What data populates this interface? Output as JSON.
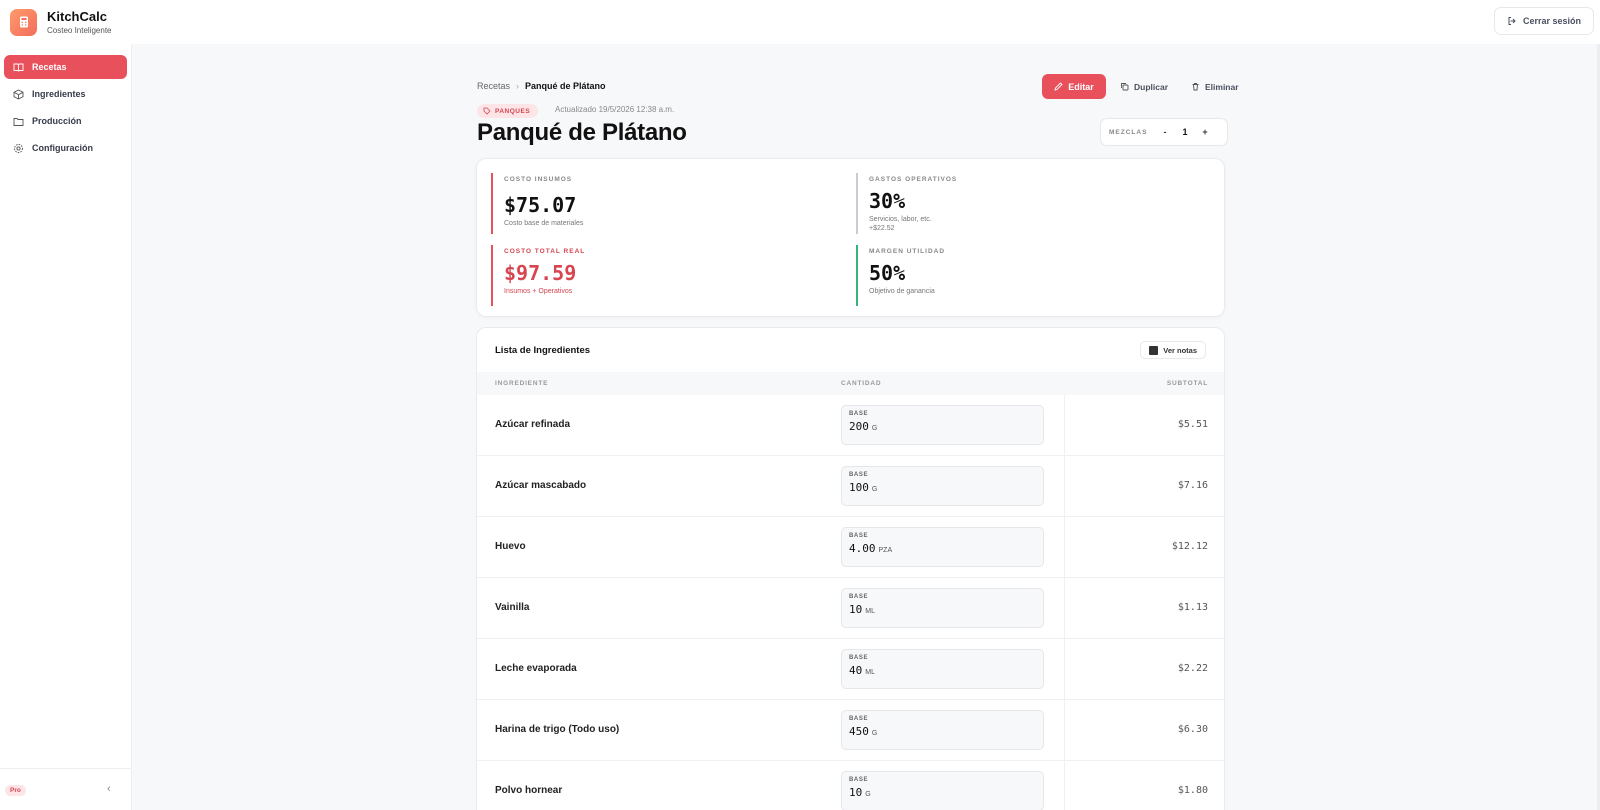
{
  "app": {
    "name": "KitchCalc",
    "tagline": "Costeo Inteligente",
    "logout_label": "Cerrar sesión"
  },
  "sidebar": {
    "items": [
      {
        "label": "Recetas",
        "icon": "book-icon",
        "active": true
      },
      {
        "label": "Ingredientes",
        "icon": "box-icon",
        "active": false
      },
      {
        "label": "Producción",
        "icon": "folder-icon",
        "active": false
      },
      {
        "label": "Configuración",
        "icon": "gear-icon",
        "active": false
      }
    ],
    "plan_badge": "Pro"
  },
  "breadcrumb": {
    "parent": "Recetas",
    "current": "Panqué de Plátano"
  },
  "actions": {
    "edit": "Editar",
    "duplicate": "Duplicar",
    "delete": "Eliminar"
  },
  "recipe": {
    "category": "PANQUES",
    "updated": "Actualizado 19/5/2026 12:38 a.m.",
    "title": "Panqué de Plátano",
    "mixes_label": "MEZCLAS",
    "mixes_value": "1",
    "minus": "-",
    "plus": "+"
  },
  "costs": {
    "materials": {
      "label": "COSTO INSUMOS",
      "value": "$75.07",
      "sub": "Costo base de materiales"
    },
    "operating": {
      "label": "GASTOS OPERATIVOS",
      "value": "30%",
      "sub": "Servicios, labor, etc.",
      "extra": "+$22.52"
    },
    "total": {
      "label": "COSTO TOTAL REAL",
      "value": "$97.59",
      "sub": "Insumos + Operativos"
    },
    "margin": {
      "label": "MARGEN UTILIDAD",
      "value": "50%",
      "sub": "Objetivo de ganancia"
    }
  },
  "ingredients": {
    "title": "Lista de Ingredientes",
    "notes_label": "Ver notas",
    "columns": [
      "INGREDIENTE",
      "CANTIDAD",
      "SUBTOTAL"
    ],
    "base_label": "BASE",
    "rows": [
      {
        "name": "Azúcar refinada",
        "qty": "200",
        "unit": "G",
        "subtotal": "$5.51"
      },
      {
        "name": "Azúcar mascabado",
        "qty": "100",
        "unit": "G",
        "subtotal": "$7.16"
      },
      {
        "name": "Huevo",
        "qty": "4.00",
        "unit": "PZA",
        "subtotal": "$12.12"
      },
      {
        "name": "Vainilla",
        "qty": "10",
        "unit": "ML",
        "subtotal": "$1.13"
      },
      {
        "name": "Leche evaporada",
        "qty": "40",
        "unit": "ML",
        "subtotal": "$2.22"
      },
      {
        "name": "Harina de trigo (Todo uso)",
        "qty": "450",
        "unit": "G",
        "subtotal": "$6.30"
      },
      {
        "name": "Polvo hornear",
        "qty": "10",
        "unit": "G",
        "subtotal": "$1.80"
      }
    ]
  },
  "colors": {
    "accent": "#e8505b",
    "operating": "#c9ccd3",
    "margin": "#34b37a"
  }
}
